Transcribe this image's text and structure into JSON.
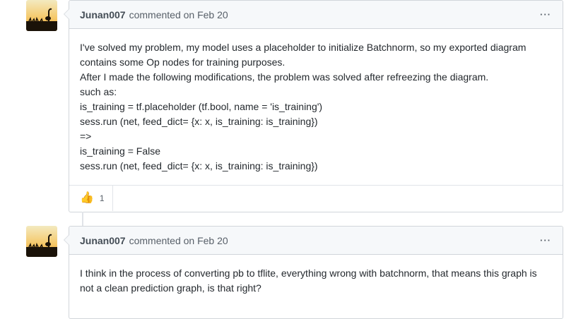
{
  "comments": [
    {
      "author": "Junan007",
      "action": "commented on",
      "date": "Feb 20",
      "menu_label": "···",
      "body_lines": [
        "I've solved my problem, my model uses a placeholder to initialize Batchnorm, so my exported diagram",
        "contains some Op nodes for training purposes.",
        "After I made the following modifications, the problem was solved after refreezing the diagram.",
        "such as:",
        "is_training = tf.placeholder (tf.bool, name = 'is_training')",
        "sess.run (net, feed_dict= {x: x, is_training: is_training})",
        "=>",
        "is_training = False",
        "sess.run (net, feed_dict= {x: x, is_training: is_training})"
      ],
      "reaction": {
        "icon": "thumbs-up",
        "emoji": "👍",
        "count": "1"
      }
    },
    {
      "author": "Junan007",
      "action": "commented on",
      "date": "Feb 20",
      "menu_label": "···",
      "body_lines": [
        "I think in the process of converting pb to tflite, everything wrong with batchnorm, that means this graph is",
        "not a clean prediction graph, is that right?"
      ]
    }
  ]
}
